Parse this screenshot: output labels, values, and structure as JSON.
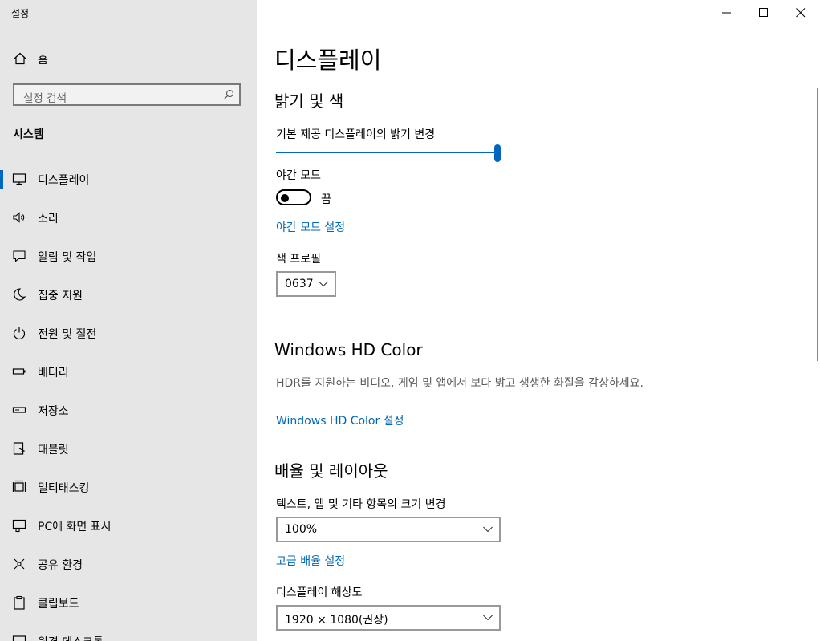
{
  "app": {
    "title": "설정"
  },
  "sidebar": {
    "home_label": "홈",
    "search_placeholder": "설정 검색",
    "section_title": "시스템",
    "items": [
      {
        "label": "디스플레이",
        "icon": "monitor-icon",
        "active": true
      },
      {
        "label": "소리",
        "icon": "speaker-icon"
      },
      {
        "label": "알림 및 작업",
        "icon": "message-icon"
      },
      {
        "label": "집중 지원",
        "icon": "moon-icon"
      },
      {
        "label": "전원 및 절전",
        "icon": "power-icon"
      },
      {
        "label": "배터리",
        "icon": "battery-icon"
      },
      {
        "label": "저장소",
        "icon": "storage-icon"
      },
      {
        "label": "태블릿",
        "icon": "tablet-icon"
      },
      {
        "label": "멀티태스킹",
        "icon": "multitask-icon"
      },
      {
        "label": "PC에 화면 표시",
        "icon": "project-icon"
      },
      {
        "label": "공유 환경",
        "icon": "share-icon"
      },
      {
        "label": "클립보드",
        "icon": "clipboard-icon"
      },
      {
        "label": "원격 데스크톱",
        "icon": "remote-icon"
      }
    ]
  },
  "main": {
    "page_title": "디스플레이",
    "brightness_section": {
      "heading": "밝기 및 색",
      "brightness_label": "기본 제공 디스플레이의 밝기 변경",
      "brightness_level": 1.0,
      "night_mode_label": "야간 모드",
      "night_mode_state": "끔",
      "night_mode_settings_link": "야간 모드 설정",
      "color_profile_label": "색 프로필",
      "color_profile_value": "0637"
    },
    "hd_color_section": {
      "heading": "Windows HD Color",
      "description": "HDR를 지원하는 비디오, 게임 및 앱에서 보다 밝고 생생한 화질을 감상하세요.",
      "settings_link": "Windows HD Color 설정"
    },
    "scale_section": {
      "heading": "배율 및 레이아웃",
      "scale_label": "텍스트, 앱 및 기타 항목의 크기 변경",
      "scale_value": "100%",
      "advanced_scale_link": "고급 배율 설정",
      "resolution_label": "디스플레이 해상도",
      "resolution_value": "1920 × 1080(권장)"
    }
  },
  "colors": {
    "accent": "#0067c0",
    "link": "#0067b8",
    "sidebar_bg": "#e6e6e6"
  }
}
